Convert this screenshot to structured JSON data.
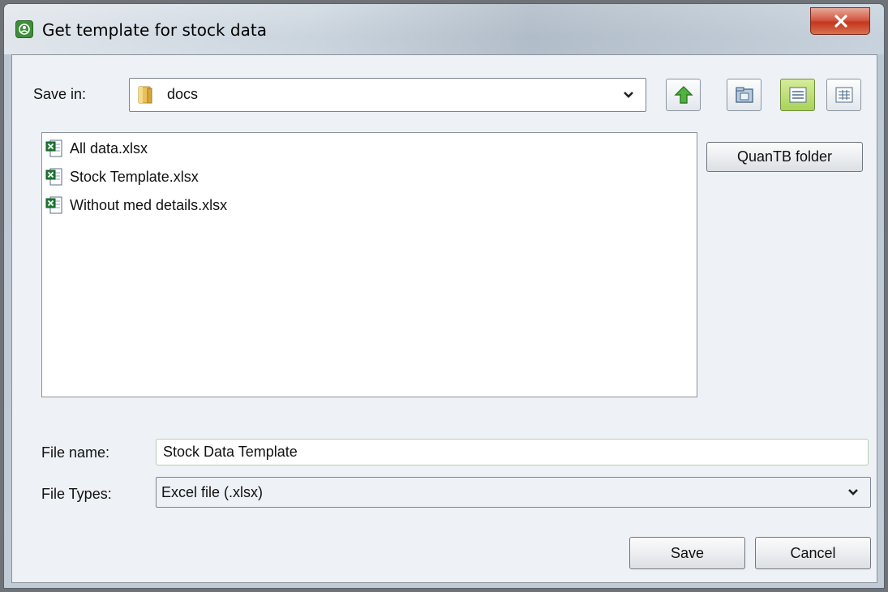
{
  "window": {
    "title": "Get template for stock data"
  },
  "save_in": {
    "label": "Save in:",
    "value": "docs",
    "icon": "folder-icon"
  },
  "toolbar": {
    "up_icon": "up-folder-icon",
    "home_icon": "home-folder-icon",
    "list_icon": "list-view-icon",
    "details_icon": "details-view-icon"
  },
  "files": [
    {
      "name": "All data.xlsx",
      "icon": "excel-file-icon"
    },
    {
      "name": "Stock Template.xlsx",
      "icon": "excel-file-icon"
    },
    {
      "name": "Without med details.xlsx",
      "icon": "excel-file-icon"
    }
  ],
  "quantb_button": "QuanTB folder",
  "file_name": {
    "label": "File name:",
    "value": "Stock Data Template"
  },
  "file_types": {
    "label": "File Types:",
    "value": "Excel file (.xlsx)"
  },
  "buttons": {
    "save": "Save",
    "cancel": "Cancel"
  },
  "colors": {
    "active_toggle": "#a9d25b",
    "close_button": "#c4361f",
    "excel_green": "#1e7b34"
  }
}
